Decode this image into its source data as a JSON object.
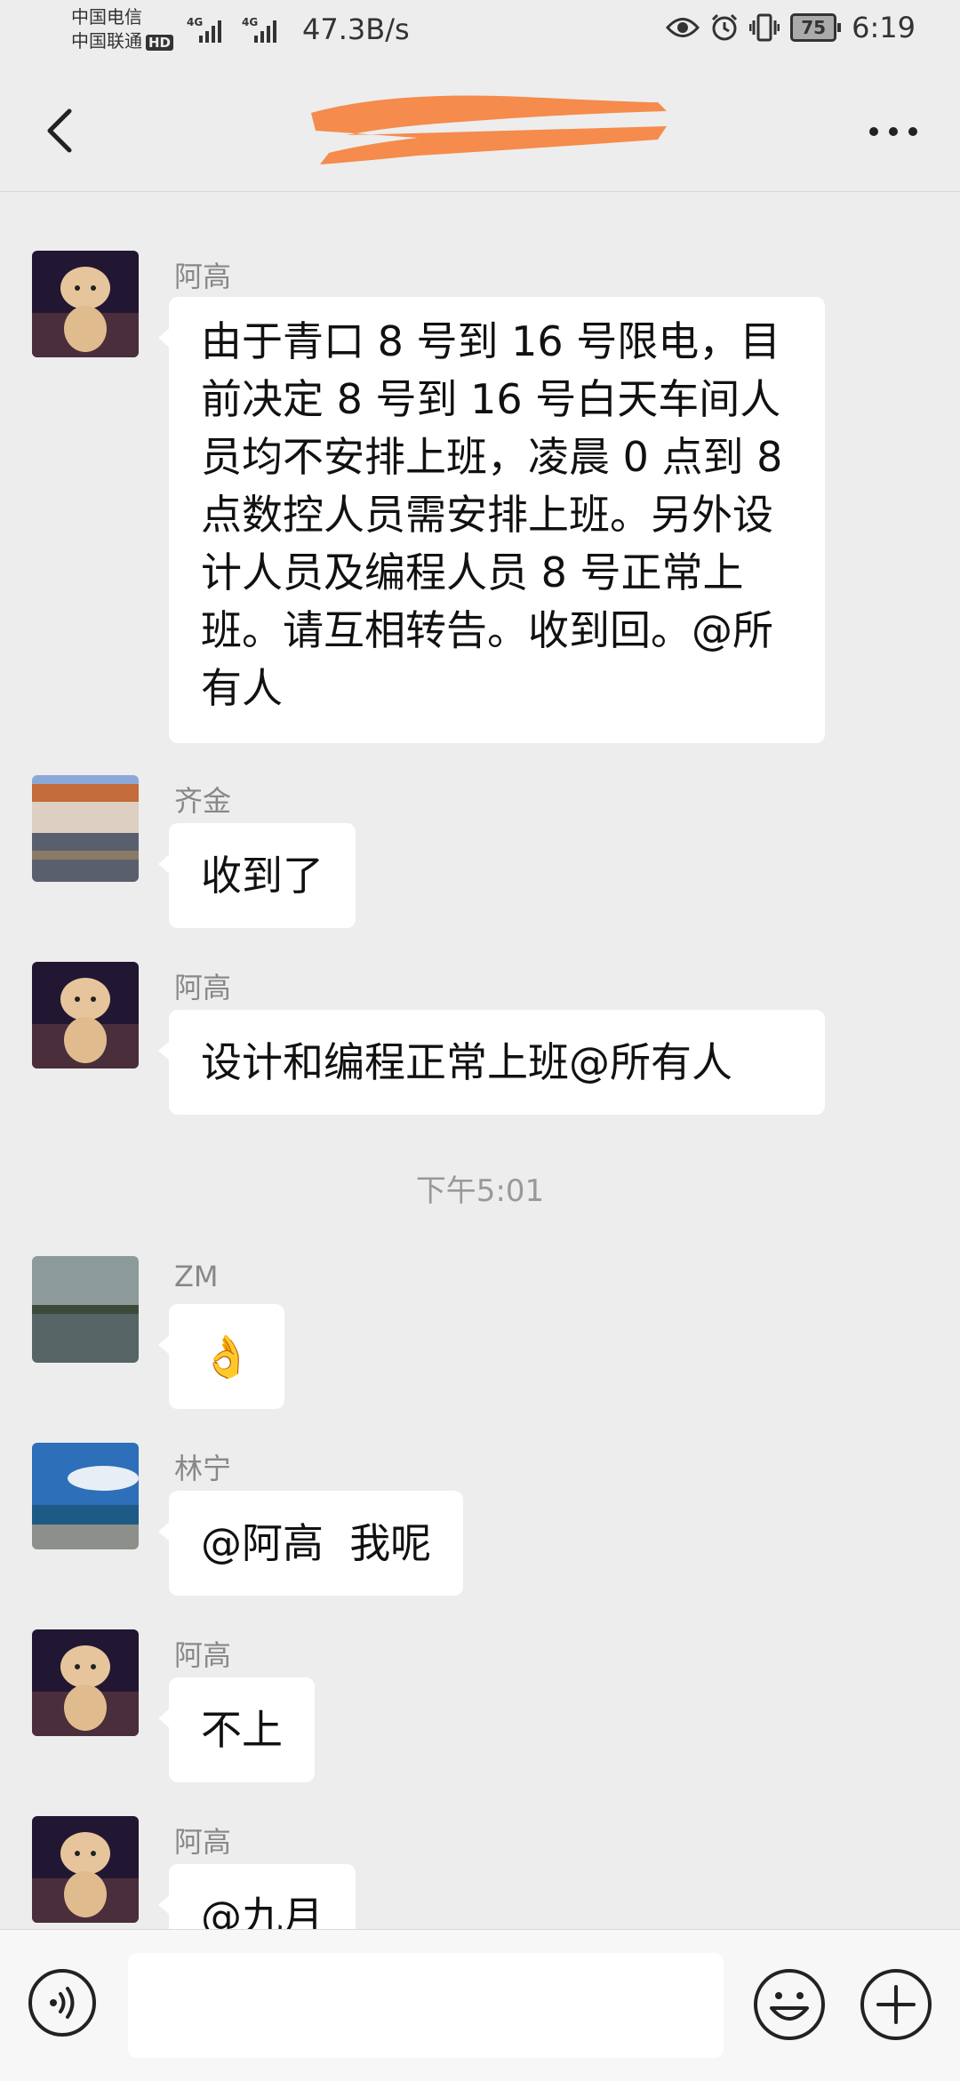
{
  "status_bar": {
    "carrier_1": "中国电信",
    "carrier_2": "中国联通",
    "hd_badge": "HD",
    "signal_tag_1": "4G",
    "signal_tag_2": "4G",
    "net_speed": "47.3B/s",
    "icons": [
      "eye-icon",
      "alarm-icon",
      "vibrate-icon"
    ],
    "battery_level": "75",
    "time": "6:19"
  },
  "header": {
    "back_icon": "chevron-left-icon",
    "more_icon": "more-dots-icon",
    "title_redaction_color": "#f58b4c"
  },
  "messages": [
    {
      "sender": "阿高",
      "text": "由于青口 8 号到 16 号限电，目前决定 8 号到 16 号白天车间人员均不安排上班，凌晨 0 点到 8 点数控人员需安排上班。另外设计人员及编程人员 8 号正常上班。请互相转告。收到回。@所有人"
    },
    {
      "sender": "齐金",
      "text": "收到了"
    },
    {
      "sender": "阿高",
      "text": "设计和编程正常上班@所有人"
    },
    {
      "sender": "ZM",
      "text": "👌"
    },
    {
      "sender": "林宁",
      "text": "@阿高  我呢"
    },
    {
      "sender": "阿高",
      "text": "不上"
    },
    {
      "sender": "阿高",
      "text": "@九月"
    }
  ],
  "timestamp": "下午5:01",
  "input_bar": {
    "voice_icon": "voice-icon",
    "input_value": "",
    "emoji_icon": "emoji-icon",
    "plus_icon": "plus-icon"
  },
  "colors": {
    "background": "#ededed",
    "bubble": "#ffffff",
    "redaction": "#f58b4c"
  }
}
